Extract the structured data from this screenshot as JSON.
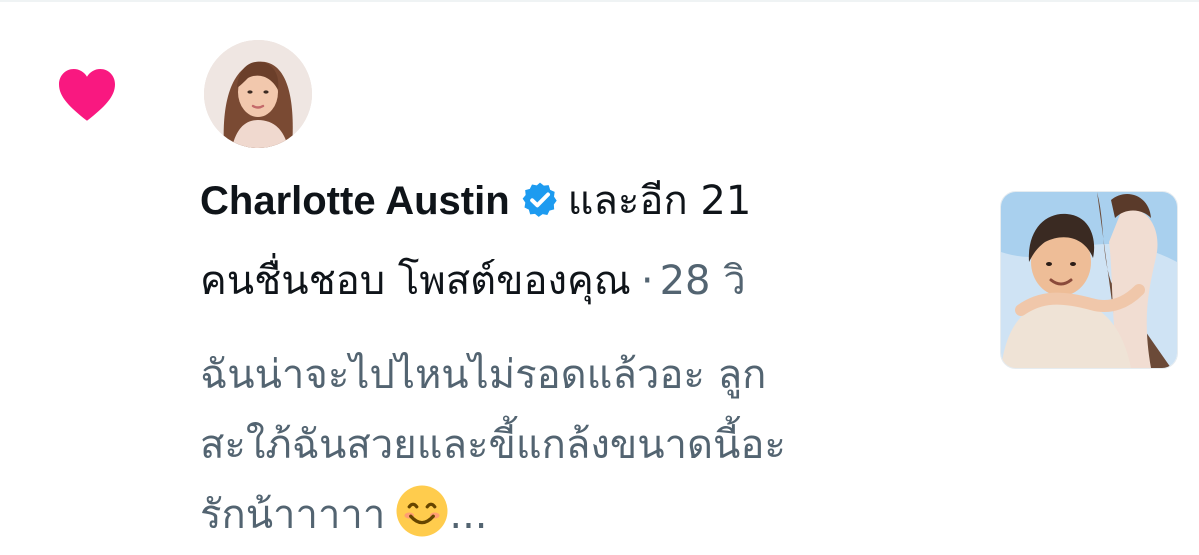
{
  "notification": {
    "type_icon": "heart-icon",
    "accent_color": "#f91880",
    "verified_color": "#1d9bf0",
    "actor_name": "Charlotte Austin",
    "actor_verified": true,
    "others_text": "และอีก 21",
    "action_text": "คนชื่นชอบ โพสต์ของคุณ",
    "separator": "·",
    "time_ago": "28 วิ",
    "post_preview_lines": [
      "ฉันน่าจะไปไหนไม่รอดแล้วอะ ลูก",
      "สะใภ้ฉันสวยและขี้แกล้งขนาดนี้อะ",
      "รักน้าาาาา"
    ],
    "post_preview_emoji": "smiling-face-icon",
    "post_preview_ellipsis": "..."
  }
}
